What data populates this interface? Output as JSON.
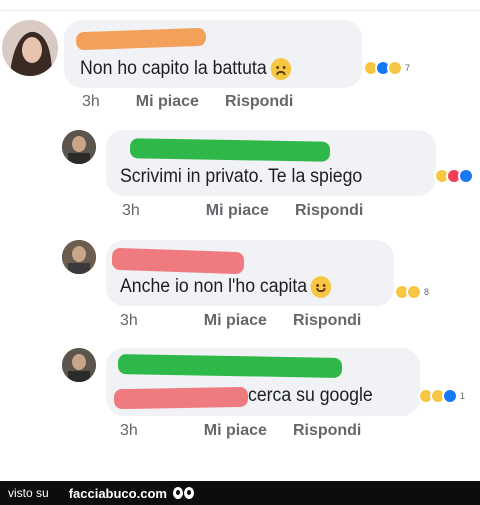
{
  "comments": [
    {
      "text": "Non ho capito la battuta",
      "emoji": "sad-face-icon",
      "reaction_count": "7",
      "time": "3h",
      "like_label": "Mi piace",
      "reply_label": "Rispondi"
    },
    {
      "text": "Scrivimi in privato. Te la spiego",
      "time": "3h",
      "like_label": "Mi piace",
      "reply_label": "Rispondi"
    },
    {
      "text": "Anche io non l'ho capita",
      "emoji": "relieved-face-icon",
      "reaction_count": "8",
      "time": "3h",
      "like_label": "Mi piace",
      "reply_label": "Rispondi"
    },
    {
      "text": "cerca su google",
      "reaction_count": "1",
      "time": "3h",
      "like_label": "Mi piace",
      "reply_label": "Rispondi"
    }
  ],
  "footer": {
    "prefix": "visto su",
    "brand": "facciabuco.com"
  },
  "colors": {
    "bubble": "#f0f2f5",
    "redaction_orange": "#f3a15a",
    "redaction_green": "#2fb84a",
    "redaction_red": "#ef7a80",
    "like_blue": "#1877f2"
  }
}
